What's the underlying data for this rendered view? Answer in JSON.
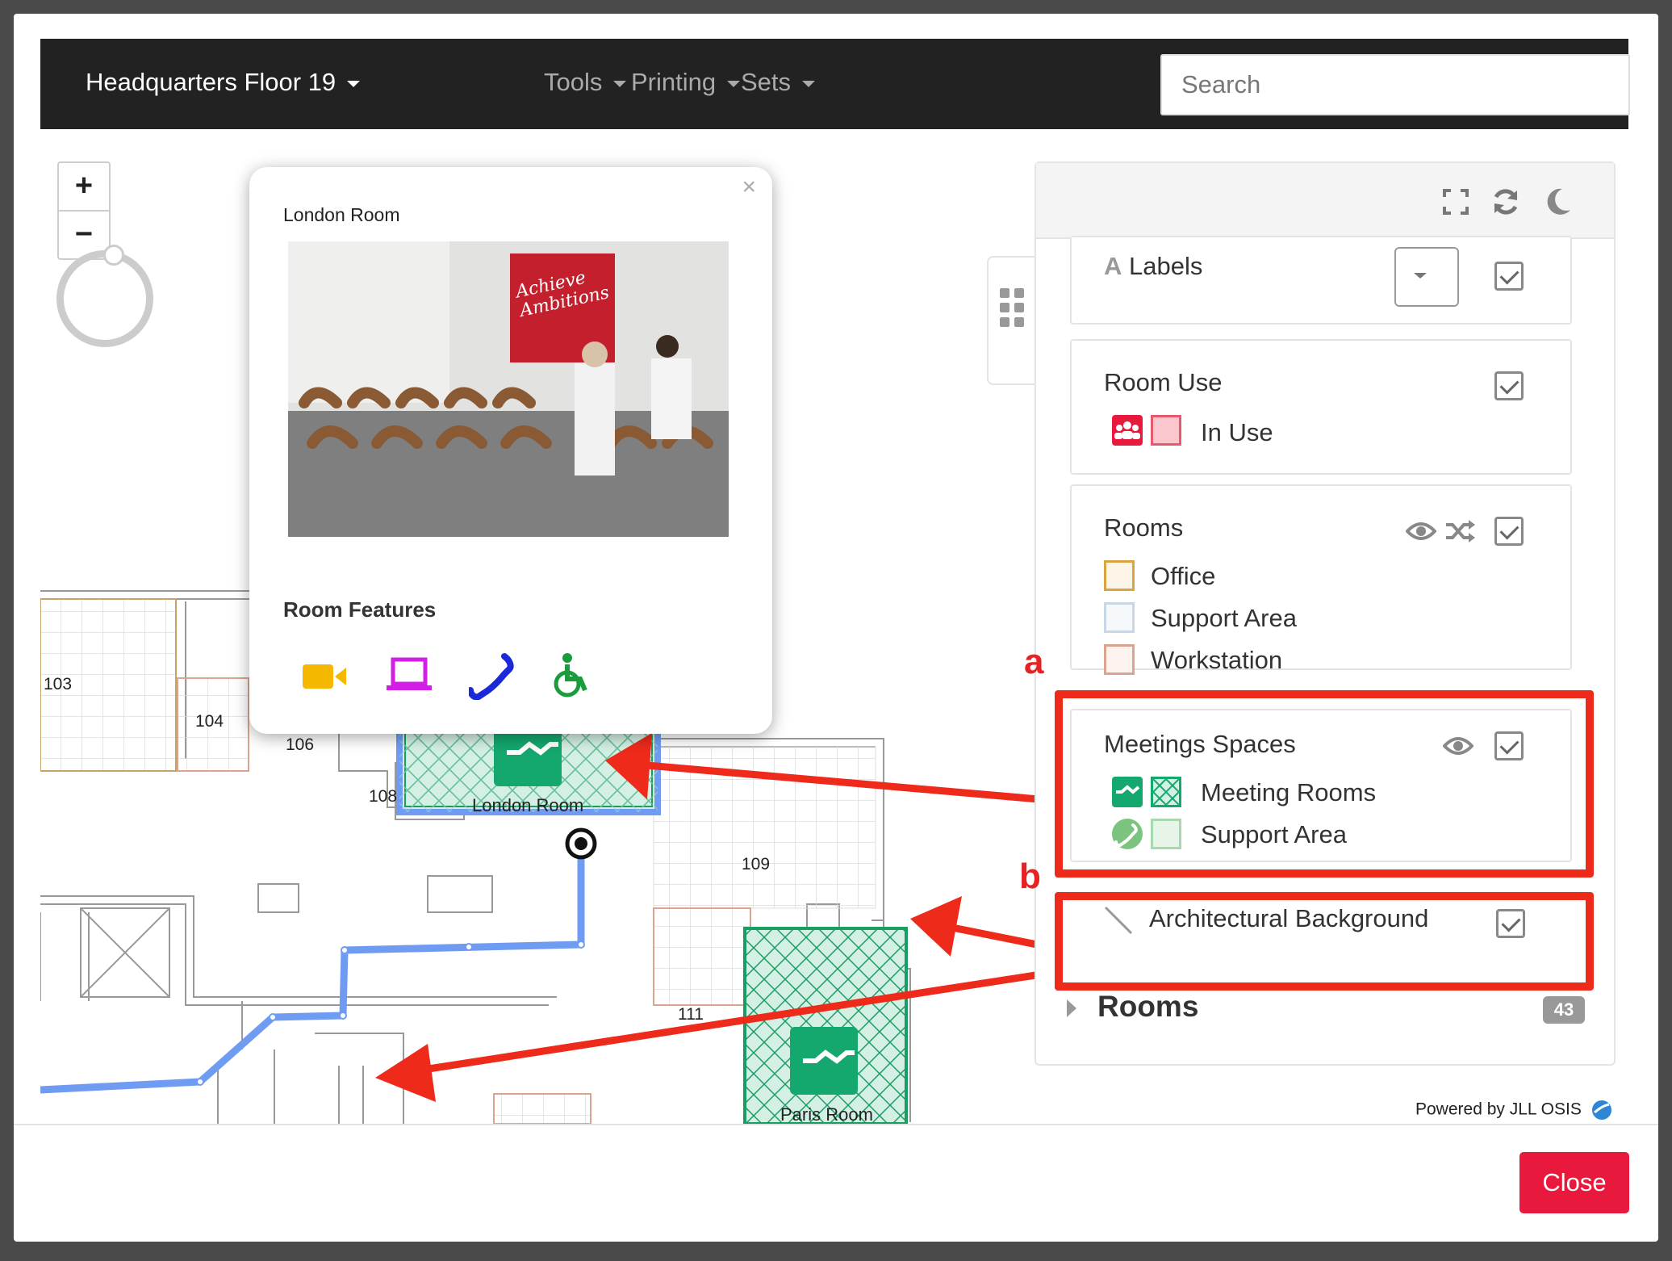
{
  "nav": {
    "title": "Headquarters Floor 19",
    "menus": [
      "Tools",
      "Printing",
      "Sets"
    ],
    "search_placeholder": "Search"
  },
  "map": {
    "zoom_in": "+",
    "zoom_out": "−",
    "room_labels": [
      "103",
      "104",
      "106",
      "108",
      "London Room",
      "109",
      "111",
      "Paris Room"
    ]
  },
  "popup": {
    "close": "×",
    "title": "London Room",
    "photo_sign": "Achieve Ambitions",
    "features_title": "Room Features",
    "features": [
      "video-camera-icon",
      "laptop-icon",
      "phone-icon",
      "wheelchair-icon"
    ]
  },
  "panel": {
    "labels_card": {
      "title": "Labels",
      "icon": "A"
    },
    "room_use": {
      "title": "Room Use",
      "items": [
        {
          "label": "In Use",
          "color": "#e8193c"
        }
      ]
    },
    "rooms": {
      "title": "Rooms",
      "items": [
        {
          "label": "Office",
          "color": "#d9a441"
        },
        {
          "label": "Support Area",
          "color": "#c9d6e6"
        },
        {
          "label": "Workstation",
          "color": "#d9a490"
        }
      ]
    },
    "meeting_spaces": {
      "title": "Meetings Spaces",
      "items": [
        {
          "label": "Meeting Rooms",
          "color": "#14a86e"
        },
        {
          "label": "Support Area",
          "color": "#7bc47f"
        }
      ]
    },
    "arch_background": {
      "title": "Architectural Background"
    },
    "rooms_list": {
      "title": "Rooms",
      "count": "43"
    }
  },
  "annotations": {
    "a": "a",
    "b": "b"
  },
  "footer": {
    "powered_by": "Powered by JLL OSIS",
    "close_label": "Close"
  },
  "colors": {
    "accent_red": "#e8193c",
    "meeting_green": "#14a86e",
    "route_blue": "#6f9cf2",
    "annotation_red": "#ee2a1b"
  }
}
